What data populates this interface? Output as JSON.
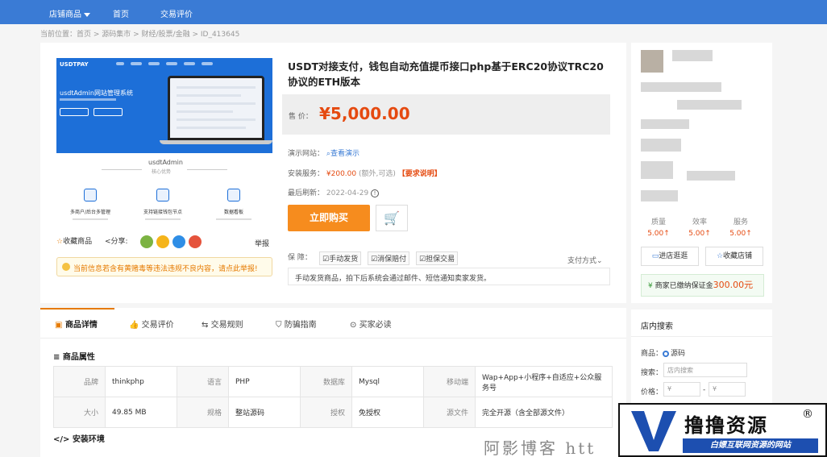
{
  "nav": {
    "items": [
      "店铺商品",
      "首页",
      "交易评价"
    ]
  },
  "breadcrumb": "当前位置：首页 > 源码集市 > 财经/股票/金融 > ID_413645",
  "product": {
    "image": {
      "brand": "USDTPAY",
      "headline": "usdtAdmin网站管理系统",
      "feature_title": "usdtAdmin",
      "feature_sub": "核心优势",
      "features": [
        "多商户/后台多管理",
        "支持链接钱包节点",
        "数据看板"
      ]
    },
    "favorite": "收藏商品",
    "share": "分享:",
    "report": "举报",
    "notice": "当前信息若含有黄赌毒等违法违规不良内容，请点此举报!",
    "title": "USDT对接支付，钱包自动充值提币接口php基于ERC20协议TRC20协议的ETH版本",
    "price_label": "售 价：",
    "price": "¥5,000.00",
    "demo_label": "演示网站：",
    "demo_link": "查看演示",
    "install_label": "安装服务：",
    "install_price": "¥200.00",
    "install_note": "(额外,可选)",
    "install_tag": "【要求说明】",
    "refresh_label": "最后刷新：",
    "refresh_date": "2022-04-29",
    "buy": "立即购买",
    "cart_icon": "cart-icon",
    "guarantee_label": "保 障：",
    "guarantees": [
      "手动发货",
      "消保赔付",
      "担保交易"
    ],
    "paymode": "支付方式",
    "ship_note": "手动发货商品，拍下后系统会通过邮件、短信通知卖家发货。"
  },
  "seller": {
    "stats": [
      {
        "label": "质量",
        "value": "5.00"
      },
      {
        "label": "效率",
        "value": "5.00"
      },
      {
        "label": "服务",
        "value": "5.00"
      }
    ],
    "enter_shop": "进店逛逛",
    "fav_shop": "收藏店铺",
    "deposit_text": "商家已缴纳保证金",
    "deposit_amount": "300.00元"
  },
  "tabs": [
    "商品详情",
    "交易评价",
    "交易规则",
    "防骗指南",
    "买家必读"
  ],
  "attributes": {
    "title": "商品属性",
    "rows": [
      [
        [
          "品牌",
          "thinkphp"
        ],
        [
          "语言",
          "PHP"
        ],
        [
          "数据库",
          "Mysql"
        ],
        [
          "移动端",
          "Wap+App+小程序+自适应+公众服务号"
        ]
      ],
      [
        [
          "大小",
          "49.85 MB"
        ],
        [
          "规格",
          "整站源码"
        ],
        [
          "授权",
          "免授权"
        ],
        [
          "源文件",
          "完全开源（含全部源文件）"
        ]
      ]
    ]
  },
  "install_env_title": "安装环境",
  "side_search": {
    "title": "店内搜索",
    "product_label": "商品：",
    "product_option": "源码",
    "search_label": "搜索：",
    "search_placeholder": "店内搜索",
    "price_label": "价格：",
    "price_from": "¥",
    "price_to": "¥"
  },
  "watermark": "阿影博客 htt",
  "logo": {
    "main": "撸撸资源",
    "reg": "®",
    "tagline": "白嫖互联网资源的网站"
  }
}
